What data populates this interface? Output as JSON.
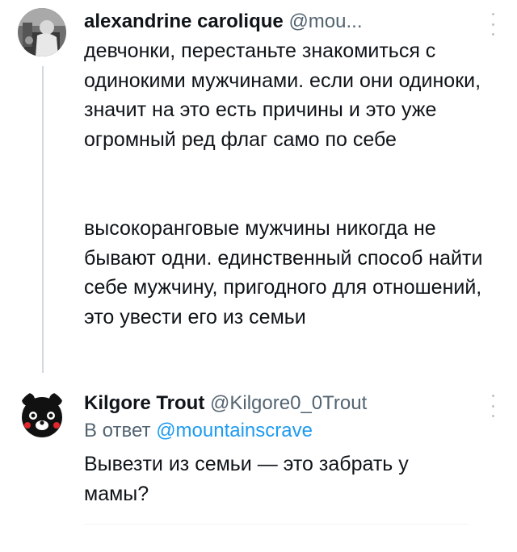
{
  "tweet1": {
    "display_name": "alexandrine carolique",
    "handle": "@mou...",
    "paragraph1": "девчонки, перестаньте знакомиться с одинокими мужчинами. если они одиноки, значит на это есть причины и это уже огромный ред флаг само по себе",
    "paragraph2": "высокоранговые мужчины никогда не бывают одни. единственный способ найти себе мужчину, пригодного для отношений, это увести его из семьи",
    "avatar_icon": "user-photo-icon",
    "menu_icon": "more-vertical-icon"
  },
  "tweet2": {
    "display_name": "Kilgore Trout",
    "handle": "@Kilgore0_0Trout",
    "reply_prefix": "В ответ",
    "reply_mention": "@mountainscrave",
    "text": "Вывезти из семьи — это забрать у мамы?",
    "avatar_icon": "kumamon-bear-icon",
    "menu_icon": "more-vertical-icon"
  },
  "colors": {
    "text": "#0f1419",
    "secondary": "#536471",
    "link": "#1d9bf0",
    "thread_line": "#cfd9de"
  }
}
